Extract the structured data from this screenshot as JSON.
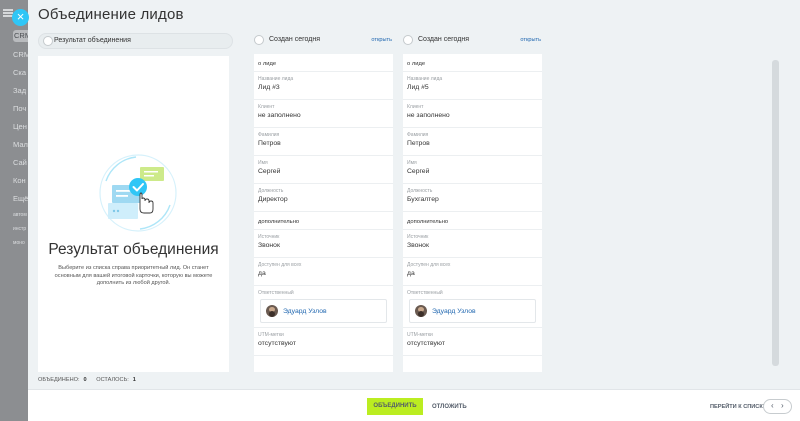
{
  "background_menu": {
    "items": [
      "CRM",
      "CRM",
      "Ска",
      "Зад",
      "Поч",
      "Цен",
      "Мал",
      "Сай",
      "Кон",
      "Ещё"
    ],
    "small_items": [
      "автом",
      "инстр",
      "моно"
    ]
  },
  "panel": {
    "title": "Объединение лидов",
    "close_glyph": "×"
  },
  "result": {
    "header_label": "Результат объединения",
    "title": "Результат объединения",
    "description": "Выберите из списка справа приоритетный лид. Он станет основным для вашей итоговой карточки, которую вы можете дополнить из любой другой."
  },
  "leads": [
    {
      "header_label": "Создан сегодня",
      "open_link": "открыть",
      "section_about": "о лиде",
      "fields_1": [
        {
          "label": "Название лида",
          "value": "Лид #3"
        },
        {
          "label": "Клиент",
          "value": "не заполнено"
        },
        {
          "label": "Фамилия",
          "value": "Петров"
        },
        {
          "label": "Имя",
          "value": "Сергей"
        },
        {
          "label": "Должность",
          "value": "Директор"
        }
      ],
      "section_extra": "дополнительно",
      "fields_2": [
        {
          "label": "Источник",
          "value": "Звонок"
        },
        {
          "label": "Доступен для всех",
          "value": "да"
        }
      ],
      "responsible_label": "Ответственный",
      "responsible_name": "Эдуард Узлов",
      "utm": {
        "label": "UTM-метки",
        "value": "отсутствуют"
      }
    },
    {
      "header_label": "Создан сегодня",
      "open_link": "открыть",
      "section_about": "о лиде",
      "fields_1": [
        {
          "label": "Название лида",
          "value": "Лид #5"
        },
        {
          "label": "Клиент",
          "value": "не заполнено"
        },
        {
          "label": "Фамилия",
          "value": "Петров"
        },
        {
          "label": "Имя",
          "value": "Сергей"
        },
        {
          "label": "Должность",
          "value": "Бухгалтер"
        }
      ],
      "section_extra": "дополнительно",
      "fields_2": [
        {
          "label": "Источник",
          "value": "Звонок"
        },
        {
          "label": "Доступен для всех",
          "value": "да"
        }
      ],
      "responsible_label": "Ответственный",
      "responsible_name": "Эдуард Узлов",
      "utm": {
        "label": "UTM-метки",
        "value": "отсутствуют"
      }
    }
  ],
  "stats": {
    "merged_label": "ОБЪЕДИНЕНО:",
    "merged_value": "0",
    "left_label": "ОСТАЛОСЬ:",
    "left_value": "1"
  },
  "footer": {
    "merge_button": "ОБЪЕДИНИТЬ",
    "postpone_button": "ОТЛОЖИТЬ",
    "go_to_list": "ПЕРЕЙТИ К СПИСКУ",
    "prev_glyph": "‹",
    "next_glyph": "›"
  },
  "colors": {
    "accent": "#2fc6f6",
    "merge_button": "#bbed21",
    "link": "#2067b0"
  }
}
